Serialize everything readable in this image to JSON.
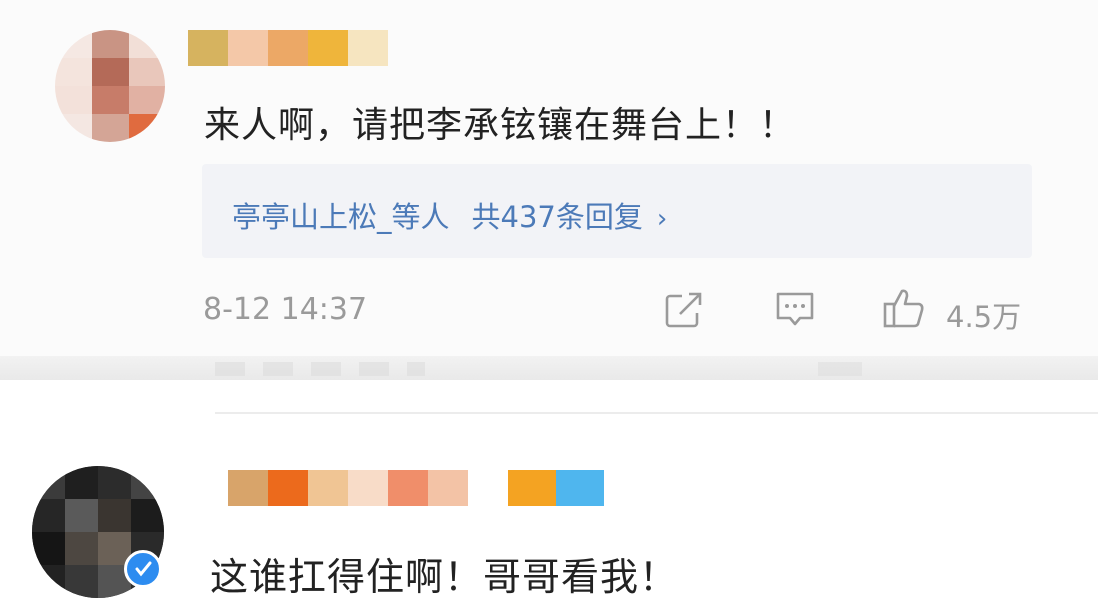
{
  "comments": [
    {
      "text": "来人啊，请把李承铉镶在舞台上！！",
      "replies_label": "亭亭山上松_等人",
      "replies_count": "共437条回复",
      "chevron": "›",
      "timestamp": "8-12 14:37",
      "like_count": "4.5万",
      "icons": [
        "share-icon",
        "comment-icon",
        "like-icon",
        "chevron-right-icon"
      ]
    },
    {
      "text": "这谁扛得住啊！哥哥看我！",
      "icons": [
        "verified-badge-icon"
      ]
    }
  ],
  "colors": {
    "link": "#4c7ab8",
    "meta": "#9a9a9a",
    "text": "#222222",
    "reply_bg": "#f2f3f7",
    "verified": "#2d8cf0"
  }
}
